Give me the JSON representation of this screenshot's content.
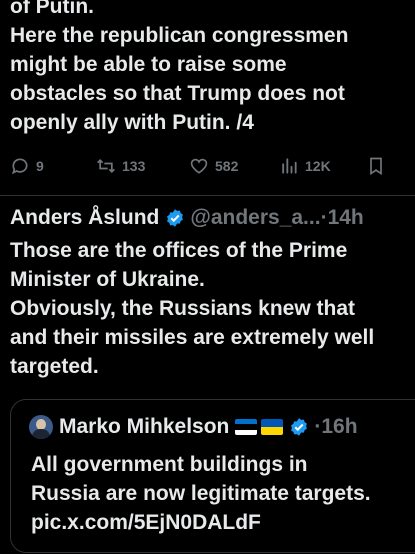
{
  "previous_tweet": {
    "text_lines": [
      "of Putin.",
      "Here the republican congressmen",
      "might be able to raise some",
      "obstacles so that Trump does not",
      "openly ally with Putin. /4"
    ],
    "actions": {
      "replies": "9",
      "reposts": "133",
      "likes": "582",
      "views": "12K"
    }
  },
  "tweet": {
    "author": "Anders Åslund",
    "handle": "@anders_a...",
    "separator": "·",
    "time": "14h",
    "text_lines": [
      "Those are the offices of the Prime",
      "Minister of Ukraine.",
      "Obviously, the Russians knew that",
      "and their missiles are extremely well",
      "targeted."
    ]
  },
  "quoted_tweet": {
    "author": "Marko Mihkelson",
    "separator": "·",
    "time": "16h",
    "text_lines": [
      "All government buildings in",
      "Russia are now legitimate targets.",
      "pic.x.com/5EjN0DALdF"
    ]
  },
  "colors": {
    "background": "#000000",
    "text": "#e7e9ea",
    "muted": "#71767b",
    "verified": "#1d9bf0",
    "divider": "#2f3336"
  }
}
